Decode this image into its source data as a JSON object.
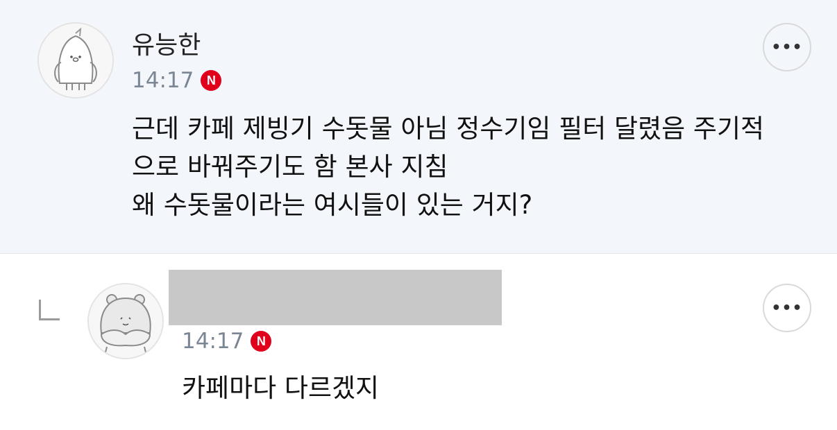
{
  "comments": [
    {
      "author": "유능한",
      "time": "14:17",
      "badge": "N",
      "avatar_icon": "penguin-avatar-icon",
      "more_label": "•••",
      "lines": [
        "근데 카페 제빙기 수돗물 아님 정수기임 필터 달렸음 주기적",
        "으로 바꿔주기도 함 본사 지침",
        "왜 수돗물이라는 여시들이 있는 거지?"
      ]
    },
    {
      "is_reply": true,
      "author_redacted": true,
      "time": "14:17",
      "badge": "N",
      "avatar_icon": "hamster-avatar-icon",
      "more_label": "•••",
      "lines": [
        "카페마다 다르겠지"
      ]
    }
  ],
  "colors": {
    "highlight_background": "#f3f6fb",
    "badge_red": "#e0001b",
    "time_gray": "#7b8695",
    "redaction_gray": "#c8c8c8"
  }
}
